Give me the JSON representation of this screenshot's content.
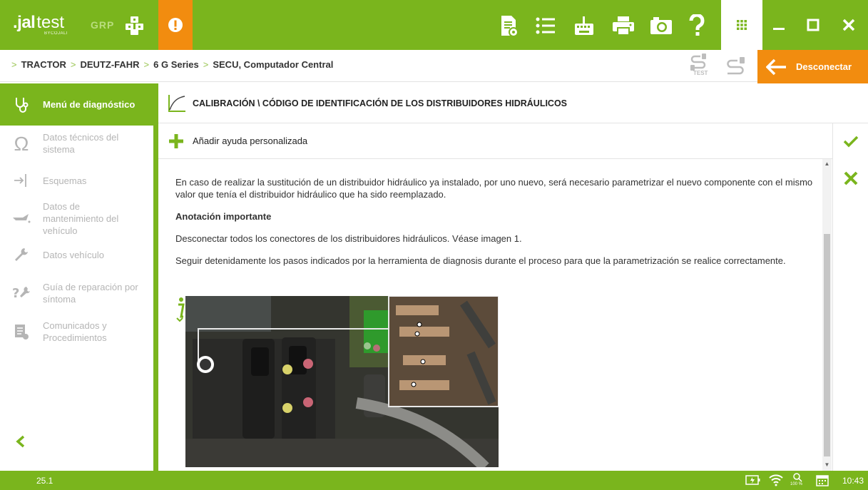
{
  "app": {
    "logo_main": ".jal",
    "logo_second": "test",
    "logo_by": "BYCOJALI",
    "grp_label": "GRP"
  },
  "breadcrumb": [
    "TRACTOR",
    "DEUTZ-FAHR",
    "6 G Series",
    "SECU, Computador Central"
  ],
  "header_icons": [
    "report-icon",
    "list-icon",
    "keyboard-icon",
    "printer-icon",
    "camera-icon",
    "help-icon",
    "apps-grid-icon"
  ],
  "window_controls": [
    "minimize-icon",
    "maximize-icon",
    "close-icon"
  ],
  "test_label": "TEST",
  "disconnect_label": "Desconectar",
  "sidebar": {
    "items": [
      {
        "label": "Menú de diagnóstico",
        "icon": "stethoscope-icon",
        "active": true
      },
      {
        "label": "Datos técnicos del sistema",
        "icon": "omega-icon"
      },
      {
        "label": "Esquemas",
        "icon": "schematic-icon"
      },
      {
        "label": "Datos de mantenimiento del vehículo",
        "icon": "oil-can-icon"
      },
      {
        "label": "Datos vehículo",
        "icon": "wrench-icon"
      },
      {
        "label": "Guía de reparación por síntoma",
        "icon": "repair-guide-icon"
      },
      {
        "label": "Comunicados y Procedimientos",
        "icon": "bulletin-icon"
      }
    ]
  },
  "main": {
    "title": "CALIBRACIÓN \\ CÓDIGO DE IDENTIFICACIÓN DE LOS DISTRIBUIDORES HIDRÁULICOS",
    "add_help": "Añadir ayuda personalizada",
    "paragraphs": [
      "En caso de realizar la sustitución de un distribuidor hidráulico ya instalado, por uno nuevo, será necesario parametrizar el nuevo componente con el mismo valor que tenía el distribuidor hidráulico que ha sido reemplazado.",
      "Anotación importante",
      "Desconectar todos los conectores de los distribuidores hidráulicos. Véase imagen 1.",
      "Seguir detenidamente los pasos indicados por la herramienta de diagnosis durante el proceso para que la parametrización se realice correctamente."
    ]
  },
  "status": {
    "version": "25.1",
    "zoom": "100 %",
    "time": "10:43"
  },
  "colors": {
    "brand_green": "#7ab51d",
    "accent_orange": "#f28c0f"
  }
}
